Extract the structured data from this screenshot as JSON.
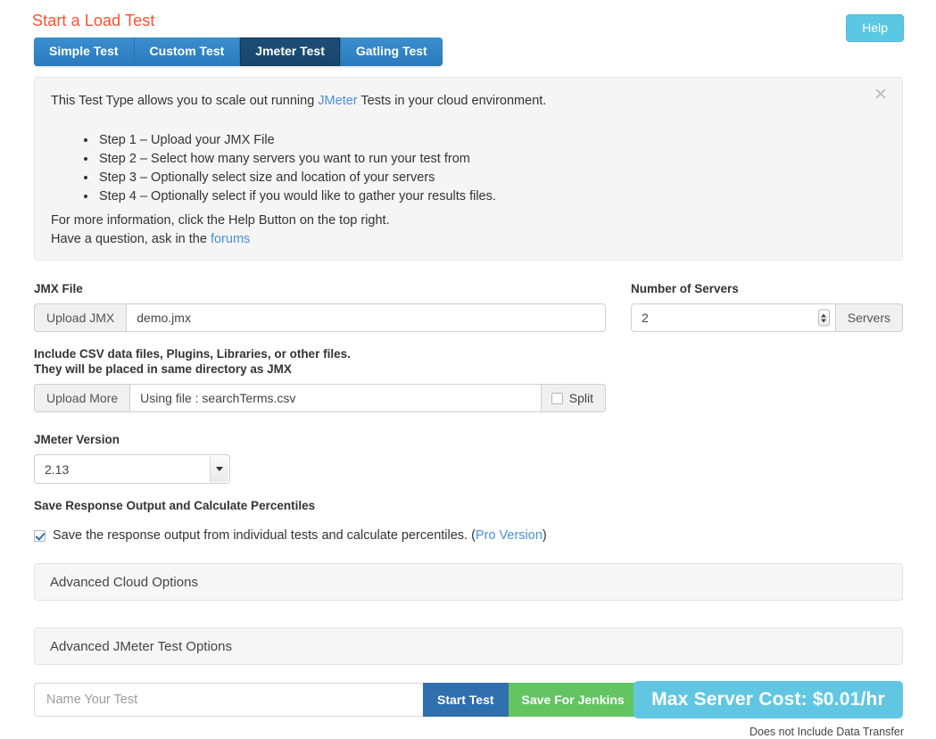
{
  "header": {
    "title": "Start a Load Test",
    "help_label": "Help",
    "title_color": "#ff4f30",
    "help_color": "#5bc8e3"
  },
  "tabs": [
    {
      "label": "Simple Test",
      "active": false
    },
    {
      "label": "Custom Test",
      "active": false
    },
    {
      "label": "Jmeter Test",
      "active": true
    },
    {
      "label": "Gatling Test",
      "active": false
    }
  ],
  "info_panel": {
    "close_icon": "close-icon",
    "lead_before": "This Test Type allows you to scale out running ",
    "lead_link": "JMeter",
    "lead_after": " Tests in your cloud environment.",
    "steps": [
      "Step 1 – Upload your JMX File",
      "Step 2 – Select how many servers you want to run your test from",
      "Step 3 – Optionally select size and location of your servers",
      "Step 4 – Optionally select if you would like to gather your results files."
    ],
    "footer_line1": "For more information, click the Help Button on the top right.",
    "footer_line2_before": "Have a question, ask in the ",
    "footer_link": "forums"
  },
  "jmx": {
    "label": "JMX File",
    "upload_button": "Upload JMX",
    "value": "demo.jmx",
    "placeholder": ""
  },
  "servers": {
    "label": "Number of Servers",
    "value": "2",
    "unit_label": "Servers",
    "spinner_icon": "spinner-updown-icon"
  },
  "csv": {
    "label_line1": "Include CSV data files, Plugins, Libraries, or other files.",
    "label_line2": "They will be placed in same directory as JMX",
    "upload_button": "Upload More",
    "value": "Using file : searchTerms.csv",
    "split_label": "Split",
    "split_checked": false
  },
  "version": {
    "label": "JMeter Version",
    "selected": "2.13",
    "options": [
      "2.13"
    ]
  },
  "save_response": {
    "label": "Save Response Output and Calculate Percentiles",
    "checked": true,
    "text": "Save the response output from individual tests and calculate percentiles. (",
    "link": "Pro Version",
    "text_after": ")"
  },
  "advanced": {
    "cloud_label": "Advanced Cloud Options",
    "jmeter_label": "Advanced JMeter Test Options"
  },
  "bottom": {
    "name_placeholder": "Name Your Test",
    "name_value": "",
    "start_label": "Start Test",
    "jenkins_label": "Save For Jenkins",
    "cost_label": "Max Server Cost: $0.01/hr",
    "cost_note": "Does not Include Data Transfer",
    "start_color": "#2f6fad",
    "jenkins_color": "#63c462",
    "cost_color": "#61c6e2"
  }
}
